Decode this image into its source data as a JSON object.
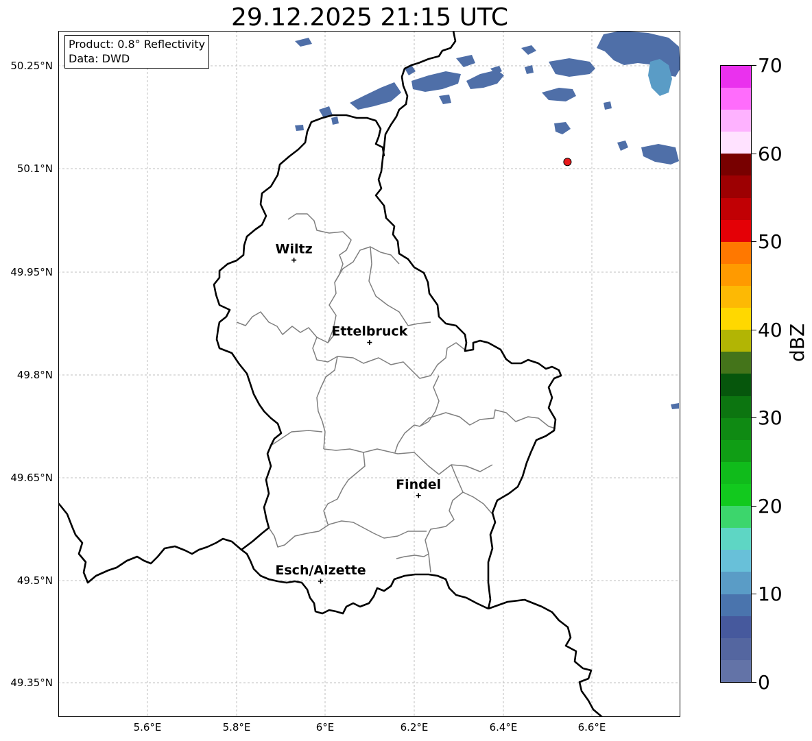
{
  "title": "29.12.2025 21:15 UTC",
  "info_box": {
    "product": "Product: 0.8° Reflectivity",
    "data_source": "Data: DWD"
  },
  "latitude_ticks": [
    "50.25°N",
    "50.1°N",
    "49.95°N",
    "49.8°N",
    "49.65°N",
    "49.5°N",
    "49.35°N"
  ],
  "longitude_ticks": [
    "5.6°E",
    "5.8°E",
    "6°E",
    "6.2°E",
    "6.4°E",
    "6.6°E"
  ],
  "cities": [
    {
      "name": "Wiltz",
      "lon": 5.93,
      "lat": 49.967
    },
    {
      "name": "Ettelbruck",
      "lon": 6.1,
      "lat": 49.847
    },
    {
      "name": "Findel",
      "lon": 6.21,
      "lat": 49.624
    },
    {
      "name": "Esch/Alzette",
      "lon": 5.99,
      "lat": 49.499
    }
  ],
  "marker": {
    "lon": 6.545,
    "lat": 50.11,
    "color": "#e8191a"
  },
  "colorbar": {
    "label": "dBZ",
    "min": 0,
    "max": 70,
    "step": 2.5,
    "tick_labels": [
      "0",
      "10",
      "20",
      "30",
      "40",
      "50",
      "60",
      "70"
    ],
    "colors": [
      "#6373a7",
      "#5466a0",
      "#46599d",
      "#4a74ad",
      "#5a9cc6",
      "#68c0d9",
      "#5ed6c4",
      "#3cd66c",
      "#12c91e",
      "#10bb1b",
      "#109e15",
      "#0f8a13",
      "#0c7510",
      "#06560c",
      "#44741a",
      "#b2b504",
      "#ffd800",
      "#fdb904",
      "#ff9a00",
      "#ff7800",
      "#e40006",
      "#c10004",
      "#9d0002",
      "#780000",
      "#ffe2ff",
      "#feb2ff",
      "#ff6cfc",
      "#ea31ee"
    ]
  },
  "colors": {
    "border": "#000000",
    "canton_lines": "#7f7f7f",
    "grid": "#bfbfbf",
    "rain": "#4f6fa8"
  }
}
